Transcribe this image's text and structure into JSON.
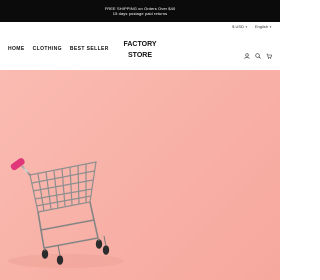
{
  "announcement": {
    "line1": "FREE SHIPPING on Orders Over $40",
    "line2": "15 days postage paid returns"
  },
  "utility": {
    "currency": "$ USD",
    "language": "English"
  },
  "nav": {
    "items": [
      "HOME",
      "CLOTHING",
      "BEST SELLER"
    ]
  },
  "logo": {
    "line1": "FACTORY",
    "line2": "STORE"
  },
  "header_icons": [
    "user-icon",
    "search-icon",
    "cart-icon"
  ],
  "hero": {
    "image": "shopping-cart-on-pink-background",
    "background_color": "#f9b5ab",
    "cart_handle_color": "#e0367a"
  }
}
